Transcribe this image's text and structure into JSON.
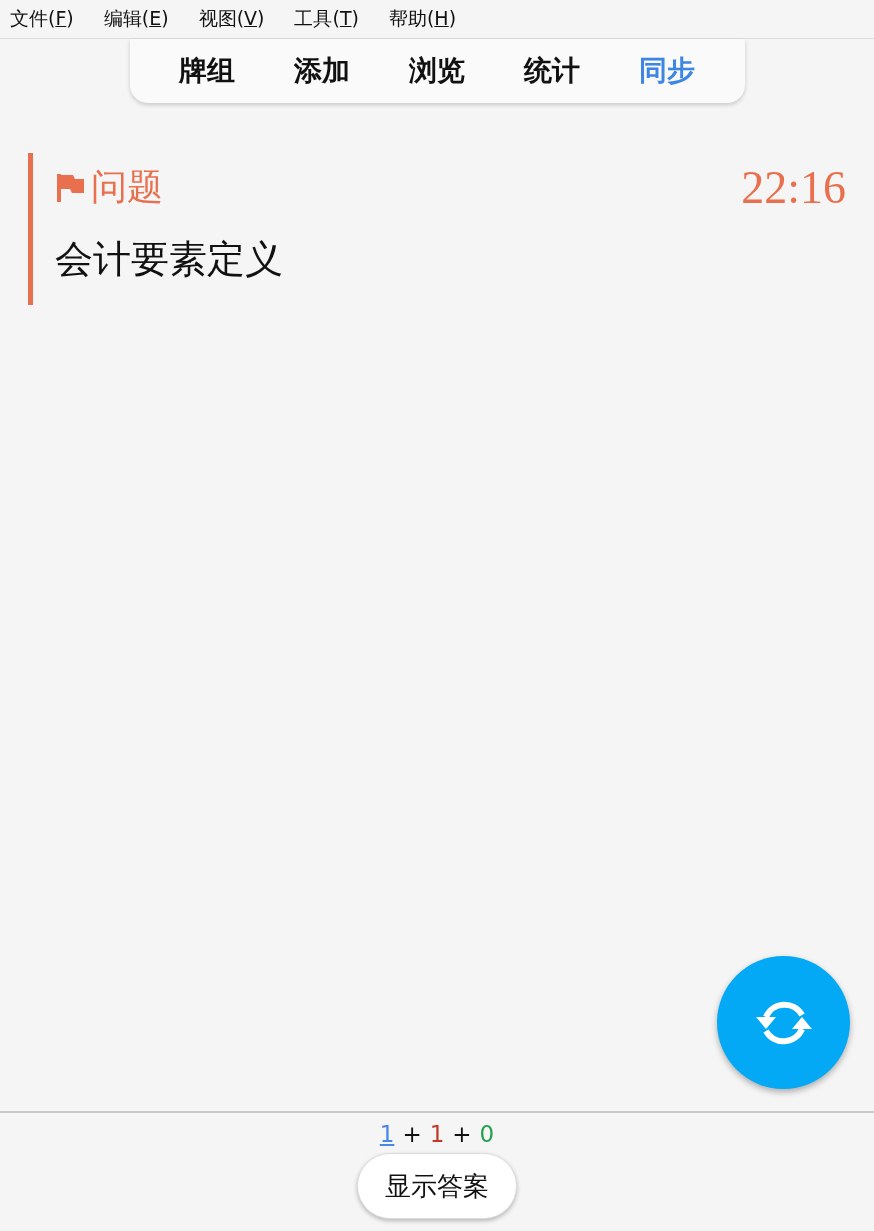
{
  "menu": [
    {
      "prefix": "文件(",
      "mnemonic": "F",
      "suffix": ")"
    },
    {
      "prefix": "编辑(",
      "mnemonic": "E",
      "suffix": ")"
    },
    {
      "prefix": "视图(",
      "mnemonic": "V",
      "suffix": ")"
    },
    {
      "prefix": "工具(",
      "mnemonic": "T",
      "suffix": ")"
    },
    {
      "prefix": "帮助(",
      "mnemonic": "H",
      "suffix": ")"
    }
  ],
  "toolbar": [
    {
      "label": "牌组",
      "highlighted": false
    },
    {
      "label": "添加",
      "highlighted": false
    },
    {
      "label": "浏览",
      "highlighted": false
    },
    {
      "label": "统计",
      "highlighted": false
    },
    {
      "label": "同步",
      "highlighted": true
    }
  ],
  "card": {
    "flagged": true,
    "heading": "问题",
    "timer": "22:16",
    "question": "会计要素定义"
  },
  "counts": [
    {
      "kind": "count",
      "text": "1",
      "color": "#4a86e8",
      "current": true
    },
    {
      "kind": "plus",
      "text": "+"
    },
    {
      "kind": "count",
      "text": "1",
      "color": "#c0392b",
      "current": false
    },
    {
      "kind": "plus",
      "text": "+"
    },
    {
      "kind": "count",
      "text": "0",
      "color": "#22a04b",
      "current": false
    }
  ],
  "answer_button": "显示答案"
}
